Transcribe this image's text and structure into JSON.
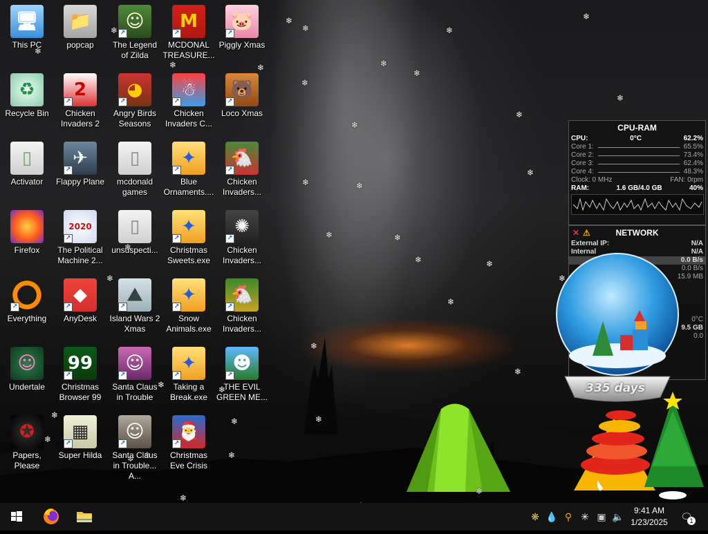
{
  "desktop": {
    "icons": [
      {
        "label": "This PC"
      },
      {
        "label": "popcap"
      },
      {
        "label": "The Legend of Zilda"
      },
      {
        "label": "MCDONAL TREASURE..."
      },
      {
        "label": "Piggly Xmas"
      },
      {
        "label": "Recycle Bin"
      },
      {
        "label": "Chicken Invaders 2"
      },
      {
        "label": "Angry Birds Seasons"
      },
      {
        "label": "Chicken Invaders C..."
      },
      {
        "label": "Loco Xmas"
      },
      {
        "label": "Activator"
      },
      {
        "label": "Flappy Plane"
      },
      {
        "label": "mcdonald games"
      },
      {
        "label": "Blue Ornaments...."
      },
      {
        "label": "Chicken Invaders..."
      },
      {
        "label": "Firefox"
      },
      {
        "label": "The Political Machine 2..."
      },
      {
        "label": "unsuspecti..."
      },
      {
        "label": "Christmas Sweets.exe"
      },
      {
        "label": "Chicken Invaders..."
      },
      {
        "label": "Everything"
      },
      {
        "label": "AnyDesk"
      },
      {
        "label": "Island Wars 2 Xmas"
      },
      {
        "label": "Snow Animals.exe"
      },
      {
        "label": "Chicken Invaders..."
      },
      {
        "label": "Undertale"
      },
      {
        "label": "Christmas Browser 99"
      },
      {
        "label": "Santa Claus in Trouble"
      },
      {
        "label": "Taking a Break.exe"
      },
      {
        "label": "THE EVIL GREEN ME..."
      },
      {
        "label": "Papers, Please"
      },
      {
        "label": "Super Hilda"
      },
      {
        "label": "Santa Claus in Trouble... A..."
      },
      {
        "label": "Christmas Eve Crisis"
      }
    ]
  },
  "cpu_ram": {
    "title": "CPU-RAM",
    "cpu_label": "CPU:",
    "cpu_temp": "0°C",
    "cpu_value": "62.2%",
    "cores": [
      {
        "label": "Core 1:",
        "value": "65.5%"
      },
      {
        "label": "Core 2:",
        "value": "73.4%"
      },
      {
        "label": "Core 3:",
        "value": "62.4%"
      },
      {
        "label": "Core 4:",
        "value": "48.3%"
      }
    ],
    "clock_label": "Clock: 0 MHz",
    "fan_label": "FAN: 0rpm",
    "ram_label": "RAM:",
    "ram_value": "1.6 GB/4.0 GB",
    "ram_percent": "40%"
  },
  "network": {
    "title": "NETWORK",
    "external_ip_label": "External IP:",
    "external_ip_value": "N/A",
    "internal_label": "Internal",
    "internal_value": "N/A",
    "speed1": "0.0 B/s",
    "speed2": "0.0 B/s",
    "total": "15.9 MB",
    "temp": "0°C",
    "disk": "9.5 GB",
    "disk_speed": "0.0"
  },
  "globe": {
    "days": "335 days"
  },
  "taskbar": {
    "start_icon": "windows-logo",
    "pinned": [
      "firefox-icon",
      "file-explorer-icon"
    ],
    "time": "9:41 AM",
    "date": "1/23/2025",
    "notification_count": "1"
  },
  "colors": {
    "taskbar": "#141414",
    "gadget_bg": "#121212",
    "graph_green": "#2fcf7b"
  }
}
